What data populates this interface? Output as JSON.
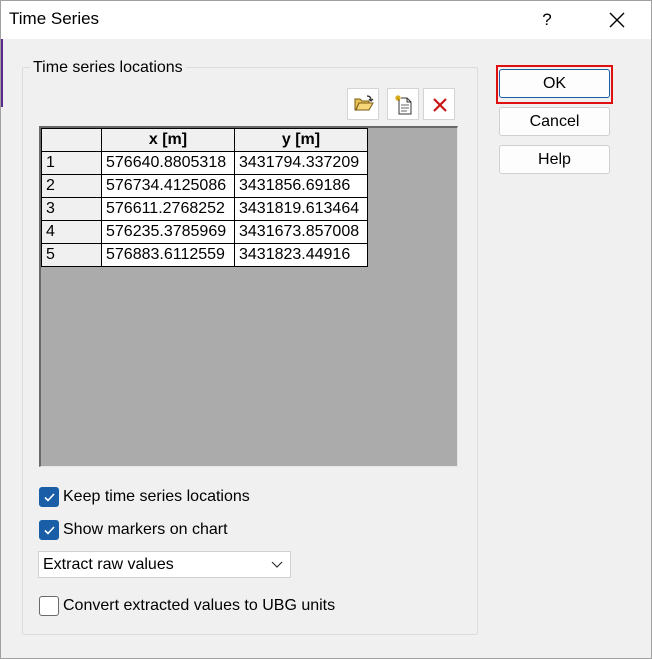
{
  "window": {
    "title": "Time Series",
    "help_label": "?"
  },
  "group": {
    "legend": "Time series locations"
  },
  "toolbar": [
    {
      "name": "open-folder-icon"
    },
    {
      "name": "new-document-icon"
    },
    {
      "name": "delete-icon"
    }
  ],
  "table": {
    "corner": "",
    "columns": [
      "x [m]",
      "y [m]"
    ],
    "rows": [
      {
        "id": "1",
        "x": "576640.8805318",
        "y": "3431794.337209"
      },
      {
        "id": "2",
        "x": "576734.4125086",
        "y": "3431856.69186"
      },
      {
        "id": "3",
        "x": "576611.2768252",
        "y": "3431819.613464"
      },
      {
        "id": "4",
        "x": "576235.3785969",
        "y": "3431673.857008"
      },
      {
        "id": "5",
        "x": "576883.6112559",
        "y": "3431823.44916"
      }
    ]
  },
  "options": {
    "keep_locations": {
      "label": "Keep time series locations",
      "checked": true
    },
    "show_markers": {
      "label": "Show markers on chart",
      "checked": true
    },
    "extract_mode": {
      "selected": "Extract raw values"
    },
    "convert_units": {
      "label": "Convert extracted values to UBG units",
      "checked": false
    }
  },
  "buttons": {
    "ok": "OK",
    "cancel": "Cancel",
    "help": "Help"
  },
  "colors": {
    "checkbox_accent": "#1a5ea8",
    "highlight": "#e01010"
  }
}
